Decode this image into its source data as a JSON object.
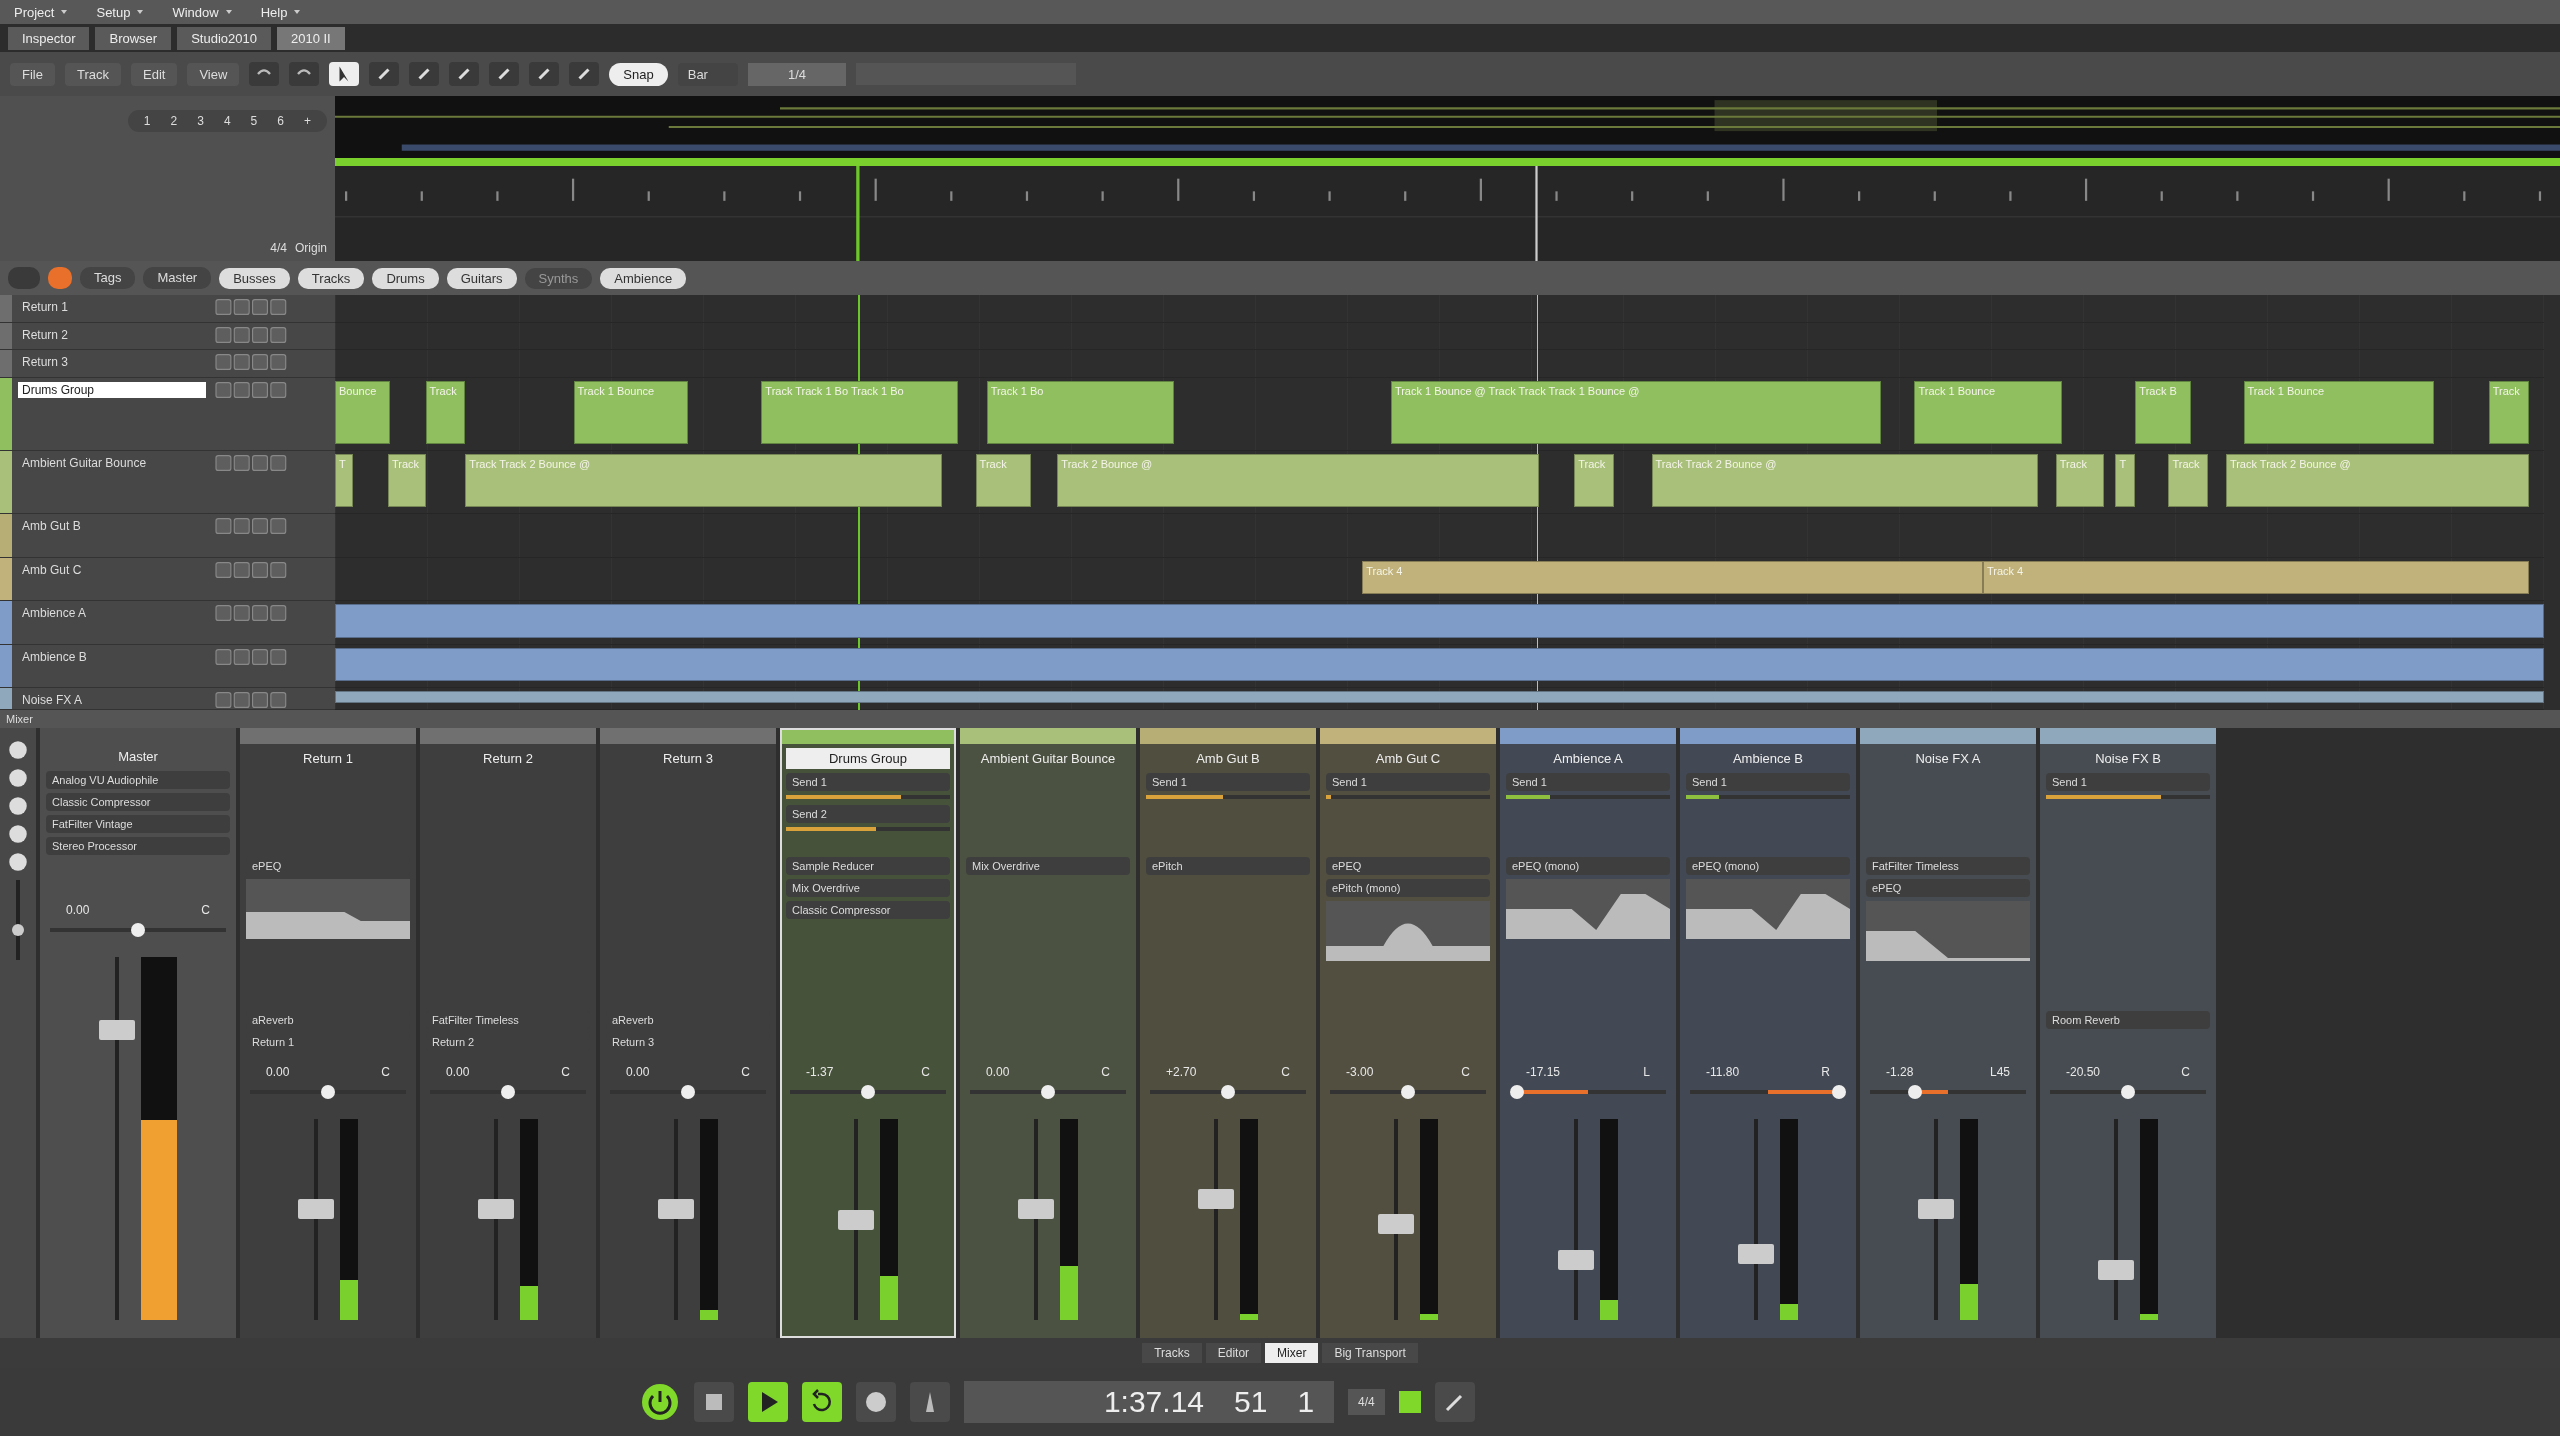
{
  "menu": [
    "Project",
    "Setup",
    "Window",
    "Help"
  ],
  "panel_tabs": [
    {
      "label": "Inspector",
      "selected": false
    },
    {
      "label": "Browser",
      "selected": false
    },
    {
      "label": "Studio2010",
      "selected": false
    },
    {
      "label": "2010 II",
      "selected": true
    }
  ],
  "toolbar": {
    "menus": [
      "File",
      "Track",
      "Edit",
      "View"
    ],
    "snap": {
      "label": "Snap",
      "on": true
    },
    "grid": "Bar",
    "quantize": "1/4"
  },
  "layout_buttons": [
    "1",
    "2",
    "3",
    "4",
    "5",
    "6",
    "+"
  ],
  "timeline": {
    "signature": "4/4",
    "origin": "Origin"
  },
  "filter_bar": {
    "tags": "Tags",
    "master": "Master",
    "groups": [
      {
        "label": "Busses",
        "on": true
      },
      {
        "label": "Tracks",
        "on": true
      },
      {
        "label": "Drums",
        "on": true
      },
      {
        "label": "Guitars",
        "on": true
      },
      {
        "label": "Synths",
        "on": false
      },
      {
        "label": "Ambience",
        "on": true
      }
    ]
  },
  "tracks": [
    {
      "name": "Return 1",
      "color": "#6e6e6e",
      "selected": false
    },
    {
      "name": "Return 2",
      "color": "#6e6e6e",
      "selected": false
    },
    {
      "name": "Return 3",
      "color": "#6e6e6e",
      "selected": false
    },
    {
      "name": "Drums Group",
      "color": "#8fbf5f",
      "selected": true,
      "clips": [
        "Bounce",
        "Track",
        "Track 1 Bounce",
        "Track Track 1 Bo Track 1 Bo",
        "Track 1 Bo",
        "Track 1 Bounce @ Track Track Track 1 Bounce @",
        "Track 1 Bounce",
        "Track B",
        "Track 1 Bounce",
        "Track"
      ]
    },
    {
      "name": "Ambient Guitar Bounce",
      "color": "#a9c07a",
      "selected": false,
      "clips": [
        "T",
        "Track",
        "Track Track 2 Bounce @",
        "Track",
        "Track 2 Bounce @",
        "Track",
        "Track Track 2 Bounce @",
        "Track",
        "T",
        "Track",
        "Track Track 2 Bounce @"
      ]
    },
    {
      "name": "Amb Gut B",
      "color": "#b6ae74",
      "selected": false
    },
    {
      "name": "Amb Gut C",
      "color": "#c0b27a",
      "selected": false,
      "clips": [
        "Track 4",
        "Track 4"
      ]
    },
    {
      "name": "Ambience A",
      "color": "#7f9cc8",
      "selected": false,
      "full_clip": true
    },
    {
      "name": "Ambience B",
      "color": "#7f9cc8",
      "selected": false,
      "full_clip": true
    },
    {
      "name": "Noise FX A",
      "color": "#8fa8bc",
      "selected": false,
      "full_clip": true
    }
  ],
  "mixer": {
    "title": "Mixer",
    "size_slider": {
      "level": 0.35
    },
    "master": {
      "name": "Master",
      "inserts": [
        "Analog VU Audiophile",
        "Classic Compressor",
        "FatFilter Vintage",
        "Stereo Processor"
      ],
      "volume": "0.00",
      "pan": {
        "value": "C",
        "level": 0.5
      },
      "fader": {
        "level": 0.8
      },
      "meter": {
        "level": 0.55
      }
    },
    "channels": [
      {
        "name": "Return 1",
        "color": "#707070",
        "selected": false,
        "inserts": [
          "ePEQ"
        ],
        "eq": {
          "kind": "flat"
        },
        "outputs": [
          "aReverb",
          "Return 1"
        ],
        "volume": "0.00",
        "pan": {
          "value": "C",
          "level": 0.5
        },
        "fader": {
          "level": 0.55
        },
        "meter": {
          "level": 0.2
        }
      },
      {
        "name": "Return 2",
        "color": "#707070",
        "selected": false,
        "outputs": [
          "FatFilter Timeless",
          "Return 2"
        ],
        "volume": "0.00",
        "pan": {
          "value": "C",
          "level": 0.5
        },
        "fader": {
          "level": 0.55
        },
        "meter": {
          "level": 0.17
        }
      },
      {
        "name": "Return 3",
        "color": "#707070",
        "selected": false,
        "outputs": [
          "aReverb",
          "Return 3"
        ],
        "volume": "0.00",
        "pan": {
          "value": "C",
          "level": 0.5
        },
        "fader": {
          "level": 0.55
        },
        "meter": {
          "level": 0.05
        }
      },
      {
        "name": "Drums Group",
        "color": "#8fbf5f",
        "selected": true,
        "sends": [
          {
            "label": "Send 1",
            "level": 0.7,
            "color": "#d9a23a"
          },
          {
            "label": "Send 2",
            "level": 0.55,
            "color": "#d9a23a"
          }
        ],
        "inserts": [
          "Sample Reducer",
          "Mix Overdrive",
          "Classic Compressor"
        ],
        "volume": "-1.37",
        "pan": {
          "value": "C",
          "level": 0.5
        },
        "fader": {
          "level": 0.5
        },
        "meter": {
          "level": 0.22
        }
      },
      {
        "name": "Ambient Guitar Bounce",
        "color": "#a9c07a",
        "selected": false,
        "inserts": [
          "Mix Overdrive"
        ],
        "volume": "0.00",
        "pan": {
          "value": "C",
          "level": 0.5
        },
        "fader": {
          "level": 0.55
        },
        "meter": {
          "level": 0.27
        }
      },
      {
        "name": "Amb Gut B",
        "color": "#b6ae74",
        "selected": false,
        "sends": [
          {
            "label": "Send 1",
            "level": 0.47,
            "color": "#d9a23a"
          }
        ],
        "inserts": [
          "ePitch"
        ],
        "volume": "+2.70",
        "pan": {
          "value": "C",
          "level": 0.5
        },
        "fader": {
          "level": 0.6
        },
        "meter": {
          "level": 0.03
        }
      },
      {
        "name": "Amb Gut C",
        "color": "#c0b27a",
        "selected": false,
        "sends": [
          {
            "label": "Send 1",
            "level": 0.03,
            "color": "#d9a23a"
          }
        ],
        "inserts": [
          "ePEQ",
          "ePitch (mono)"
        ],
        "eq": {
          "kind": "bell"
        },
        "volume": "-3.00",
        "pan": {
          "value": "C",
          "level": 0.5
        },
        "fader": {
          "level": 0.48
        },
        "meter": {
          "level": 0.03
        }
      },
      {
        "name": "Ambience A",
        "color": "#7f9cc8",
        "selected": false,
        "sends": [
          {
            "label": "Send 1",
            "level": 0.27,
            "color": "#8fbf3f"
          }
        ],
        "inserts": [
          "ePEQ (mono)"
        ],
        "eq": {
          "kind": "shelf"
        },
        "volume": "-17.15",
        "pan": {
          "value": "L",
          "level": 0.0
        },
        "fader": {
          "level": 0.3
        },
        "meter": {
          "level": 0.1
        }
      },
      {
        "name": "Ambience B",
        "color": "#7f9cc8",
        "selected": false,
        "sends": [
          {
            "label": "Send 1",
            "level": 0.2,
            "color": "#8fbf3f"
          }
        ],
        "inserts": [
          "ePEQ (mono)"
        ],
        "eq": {
          "kind": "shelf"
        },
        "volume": "-11.80",
        "pan": {
          "value": "R",
          "level": 1.0
        },
        "fader": {
          "level": 0.33
        },
        "meter": {
          "level": 0.08
        }
      },
      {
        "name": "Noise FX A",
        "color": "#8fa8bc",
        "selected": false,
        "inserts": [
          "FatFilter Timeless",
          "ePEQ"
        ],
        "eq": {
          "kind": "lowcut"
        },
        "volume": "-1.28",
        "pan": {
          "value": "L45",
          "level": 0.27
        },
        "fader": {
          "level": 0.55
        },
        "meter": {
          "level": 0.18
        }
      },
      {
        "name": "Noise FX B",
        "color": "#8fa8bc",
        "selected": false,
        "sends": [
          {
            "label": "Send 1",
            "level": 0.7,
            "color": "#d9a23a"
          }
        ],
        "outputs": [
          "Room Reverb"
        ],
        "volume": "-20.50",
        "pan": {
          "value": "C",
          "level": 0.5
        },
        "fader": {
          "level": 0.25
        },
        "meter": {
          "level": 0.03
        }
      }
    ]
  },
  "view_tabs": [
    {
      "label": "Tracks",
      "selected": false
    },
    {
      "label": "Editor",
      "selected": false
    },
    {
      "label": "Mixer",
      "selected": true
    },
    {
      "label": "Big Transport",
      "selected": false
    }
  ],
  "transport": {
    "playing": true,
    "looping": true,
    "time": "1:37.14",
    "bar": "51",
    "beat": "1",
    "signature": "4/4"
  }
}
